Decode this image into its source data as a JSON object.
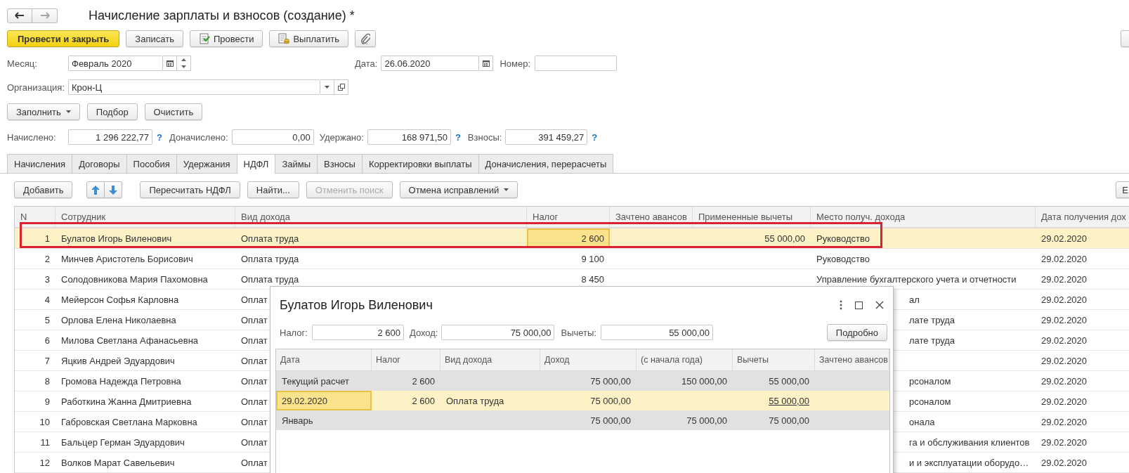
{
  "window": {
    "title": "Начисление зарплаты и взносов (создание) *",
    "nav": [
      {
        "kind": "back",
        "disabled": false
      },
      {
        "kind": "forward",
        "disabled": true
      }
    ]
  },
  "command_bar": [
    {
      "label": "Провести и закрыть",
      "kind": "primary"
    },
    {
      "label": "Записать",
      "kind": "plain"
    },
    {
      "label": "Провести",
      "kind": "post"
    },
    {
      "label": "Выплатить",
      "kind": "pay"
    },
    {
      "kind": "attach"
    }
  ],
  "header_fields": {
    "month": {
      "label": "Месяц:",
      "value": "Февраль 2020"
    },
    "date": {
      "label": "Дата:",
      "value": "26.06.2020"
    },
    "number": {
      "label": "Номер:"
    },
    "organization": {
      "label": "Организация:",
      "value": "Крон-Ц"
    }
  },
  "fill_buttons": [
    {
      "label": "Заполнить",
      "dropdown": true
    },
    {
      "label": "Подбор",
      "dropdown": false
    },
    {
      "label": "Очистить",
      "dropdown": false
    }
  ],
  "totals": [
    {
      "label": "Начислено:",
      "value": "1 296 222,77",
      "help": "?"
    },
    {
      "label": "Доначислено:",
      "value": "0,00"
    },
    {
      "label": "Удержано:",
      "value": "168 971,50",
      "help": "?"
    },
    {
      "label": "Взносы:",
      "value": "391 459,27",
      "help": "?"
    }
  ],
  "tabs": [
    {
      "label": "Начисления",
      "selected": false
    },
    {
      "label": "Договоры",
      "selected": false
    },
    {
      "label": "Пособия",
      "selected": false
    },
    {
      "label": "Удержания",
      "selected": false
    },
    {
      "label": "НДФЛ",
      "selected": true
    },
    {
      "label": "Займы",
      "selected": false
    },
    {
      "label": "Взносы",
      "selected": false
    },
    {
      "label": "Корректировки выплаты",
      "selected": false
    },
    {
      "label": "Доначисления, перерасчеты",
      "selected": false
    }
  ],
  "table_toolbar": [
    {
      "label": "Добавить",
      "kind": "button",
      "disabled": false
    },
    {
      "kind": "move_up",
      "disabled": false
    },
    {
      "kind": "move_down",
      "disabled": false
    },
    {
      "label": "Пересчитать НДФЛ",
      "kind": "button",
      "disabled": false
    },
    {
      "label": "Найти...",
      "kind": "button",
      "disabled": false
    },
    {
      "label": "Отменить поиск",
      "kind": "button",
      "disabled": true
    },
    {
      "label": "Отмена исправлений",
      "kind": "dropdown",
      "disabled": false
    },
    {
      "label": "Е",
      "kind": "edge",
      "disabled": false
    }
  ],
  "table": {
    "columns": [
      "N",
      "Сотрудник",
      "Вид дохода",
      "Налог",
      "Зачтено авансов",
      "Примененные вычеты",
      "Место получ. дохода",
      "Дата получения дох"
    ],
    "rows": [
      {
        "n": "1",
        "employee": "Булатов Игорь Виленович",
        "income_type": "Оплата труда",
        "tax": "2 600",
        "deductions": "55 000,00",
        "place": "Руководство",
        "date": "29.02.2020",
        "selected": true,
        "tax_focused": true,
        "covered": false
      },
      {
        "n": "2",
        "employee": "Минчев Аристотель Борисович",
        "income_type": "Оплата труда",
        "tax": "9 100",
        "place": "Руководство",
        "date": "29.02.2020",
        "selected": false,
        "tax_focused": false,
        "covered": false
      },
      {
        "n": "3",
        "employee": "Солодовникова Мария Пахомовна",
        "income_type": "Оплата труда",
        "tax": "8 450",
        "place": "Управление бухгалтерского учета и отчетности",
        "date": "29.02.2020",
        "selected": false,
        "tax_focused": false,
        "covered": false
      },
      {
        "n": "4",
        "employee": "Мейерсон Софья Карловна",
        "income_type": "Оплат",
        "place": "ал",
        "date": "29.02.2020",
        "selected": false,
        "covered": true
      },
      {
        "n": "5",
        "employee": "Орлова Елена Николаевна",
        "income_type": "Оплат",
        "place": "лате труда",
        "date": "29.02.2020",
        "selected": false,
        "covered": true
      },
      {
        "n": "6",
        "employee": "Милова Светлана Афанасьевна",
        "income_type": "Оплат",
        "place": "лате труда",
        "date": "29.02.2020",
        "selected": false,
        "covered": true
      },
      {
        "n": "7",
        "employee": "Яцкив Андрей Эдуардович",
        "income_type": "Оплат",
        "date": "29.02.2020",
        "selected": false
      },
      {
        "n": "8",
        "employee": "Громова Надежда Петровна",
        "income_type": "Оплат",
        "place": "рсоналом",
        "date": "29.02.2020",
        "selected": false,
        "covered": true
      },
      {
        "n": "9",
        "employee": "Работкина Жанна Дмитриевна",
        "income_type": "Оплат",
        "place": "рсоналом",
        "date": "29.02.2020",
        "selected": false,
        "covered": true
      },
      {
        "n": "10",
        "employee": "Габровская Светлана Марковна",
        "income_type": "Оплат",
        "place": "онала",
        "date": "29.02.2020",
        "selected": false,
        "covered": true
      },
      {
        "n": "11",
        "employee": "Бальцер Герман Эдуардович",
        "income_type": "Оплат",
        "place": "га и обслуживания клиентов",
        "date": "29.02.2020",
        "selected": false,
        "covered": true
      },
      {
        "n": "12",
        "employee": "Волков Марат Савельевич",
        "income_type": "Оплат",
        "place": "и и эксплуатации оборудо…",
        "date": "29.02.2020",
        "selected": false,
        "covered": true
      }
    ]
  },
  "popup": {
    "title": "Булатов Игорь Виленович",
    "fields": [
      {
        "label": "Налог:",
        "value": "2 600"
      },
      {
        "label": "Доход:",
        "value": "75 000,00"
      },
      {
        "label": "Вычеты:",
        "value": "55 000,00"
      }
    ],
    "details_button": "Подробно",
    "columns": [
      "Дата",
      "Налог",
      "Вид дохода",
      "Доход",
      "(с начала года)",
      "Вычеты",
      "Зачтено авансов"
    ],
    "rows": [
      {
        "kind": "total",
        "selected": false,
        "date": "Текущий расчет",
        "tax": "2 600",
        "income": "75 000,00",
        "income_ytd": "150 000,00",
        "deductions": "55 000,00"
      },
      {
        "kind": "entry",
        "selected": true,
        "date": "29.02.2020",
        "tax": "2 600",
        "income_type": "Оплата труда",
        "income": "75 000,00",
        "deductions": "55 000,00"
      },
      {
        "kind": "total",
        "selected": false,
        "date": "Январь",
        "income": "75 000,00",
        "income_ytd": "75 000,00",
        "deductions": "75 000,00"
      }
    ]
  }
}
